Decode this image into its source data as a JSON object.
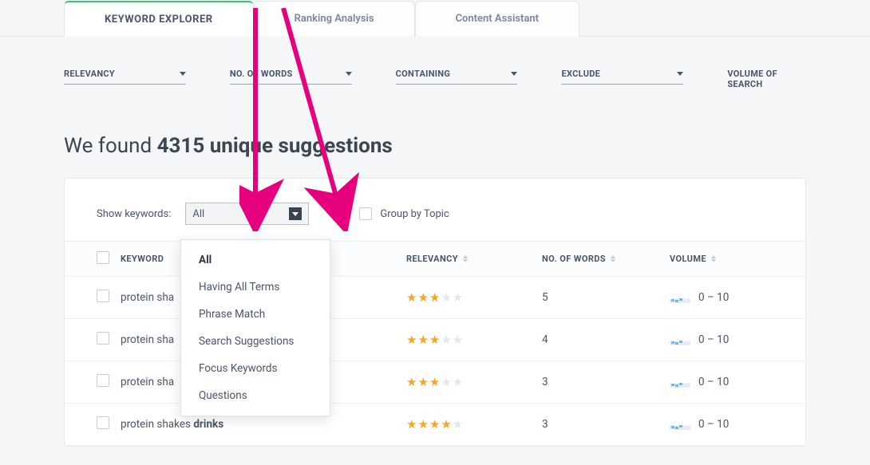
{
  "tabs": [
    {
      "label": "KEYWORD EXPLORER",
      "active": true
    },
    {
      "label": "Ranking Analysis",
      "active": false
    },
    {
      "label": "Content Assistant",
      "active": false
    }
  ],
  "filters": {
    "relevancy": "RELEVANCY",
    "words": "NO. OF WORDS",
    "containing": "CONTAINING",
    "exclude": "EXCLUDE",
    "volume": "VOLUME OF SEARCH"
  },
  "heading_prefix": "We found ",
  "heading_count": "4315 unique suggestions",
  "controls": {
    "show_label": "Show keywords:",
    "selected": "All",
    "group_label": "Group by Topic"
  },
  "dropdown": {
    "items": [
      "All",
      "Having All Terms",
      "Phrase Match",
      "Search Suggestions",
      "Focus Keywords",
      "Questions"
    ],
    "active": "All"
  },
  "columns": {
    "keyword": "KEYWORD",
    "relevancy": "RELEVANCY",
    "words": "NO. OF WORDS",
    "volume": "VOLUME"
  },
  "rows": [
    {
      "keyword": "protein sha",
      "bold": "",
      "stars": 3,
      "words": 5,
      "volume": "0 – 10"
    },
    {
      "keyword": "protein sha",
      "bold": "",
      "stars": 3,
      "words": 4,
      "volume": "0 – 10"
    },
    {
      "keyword": "protein sha",
      "bold": "",
      "stars": 3,
      "words": 3,
      "volume": "0 – 10"
    },
    {
      "keyword": "protein shakes ",
      "bold": "drinks",
      "stars": 4,
      "words": 3,
      "volume": "0 – 10"
    }
  ],
  "colors": {
    "accent": "#2ecc71",
    "arrow": "#e6007e",
    "star": "#f5a623"
  }
}
